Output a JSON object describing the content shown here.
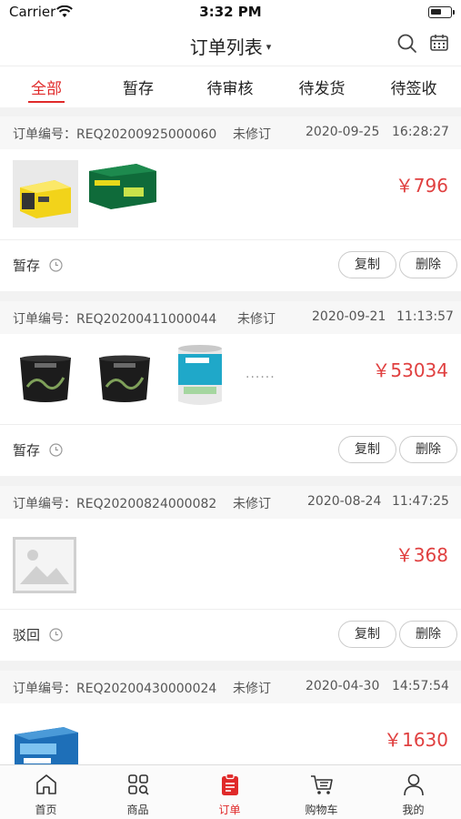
{
  "status_bar": {
    "carrier": "Carrier",
    "time": "3:32 PM"
  },
  "header": {
    "title": "订单列表",
    "caret": "▾",
    "search_icon": "search-icon",
    "calendar_icon": "calendar-icon"
  },
  "tabs": [
    {
      "label": "全部",
      "active": true
    },
    {
      "label": "暂存",
      "active": false
    },
    {
      "label": "待审核",
      "active": false
    },
    {
      "label": "待发货",
      "active": false
    },
    {
      "label": "待签收",
      "active": false
    }
  ],
  "orders": [
    {
      "order_no": "订单编号：REQ20200925000060",
      "revision": "未修订",
      "date": "2020-09-25",
      "time": "16:28:27",
      "price": "￥796",
      "status": "暂存",
      "copy_label": "复制",
      "delete_label": "删除"
    },
    {
      "order_no": "订单编号：REQ20200411000044",
      "revision": "未修订",
      "date": "2020-09-21",
      "time": "11:13:57",
      "price": "￥53034",
      "more": "......",
      "status": "暂存",
      "copy_label": "复制",
      "delete_label": "删除"
    },
    {
      "order_no": "订单编号：REQ20200824000082",
      "revision": "未修订",
      "date": "2020-08-24",
      "time": "11:47:25",
      "price": "￥368",
      "status": "驳回",
      "copy_label": "复制",
      "delete_label": "删除"
    },
    {
      "order_no": "订单编号：REQ20200430000024",
      "revision": "未修订",
      "date": "2020-04-30",
      "time": "14:57:54",
      "price": "￥1630"
    }
  ],
  "tabbar": [
    {
      "label": "首页",
      "icon": "home-icon"
    },
    {
      "label": "商品",
      "icon": "grid-search-icon"
    },
    {
      "label": "订单",
      "icon": "order-clipboard-icon",
      "active": true
    },
    {
      "label": "购物车",
      "icon": "cart-icon"
    },
    {
      "label": "我的",
      "icon": "user-icon"
    }
  ],
  "colors": {
    "accent": "#e02a2a",
    "price": "#e04040"
  }
}
